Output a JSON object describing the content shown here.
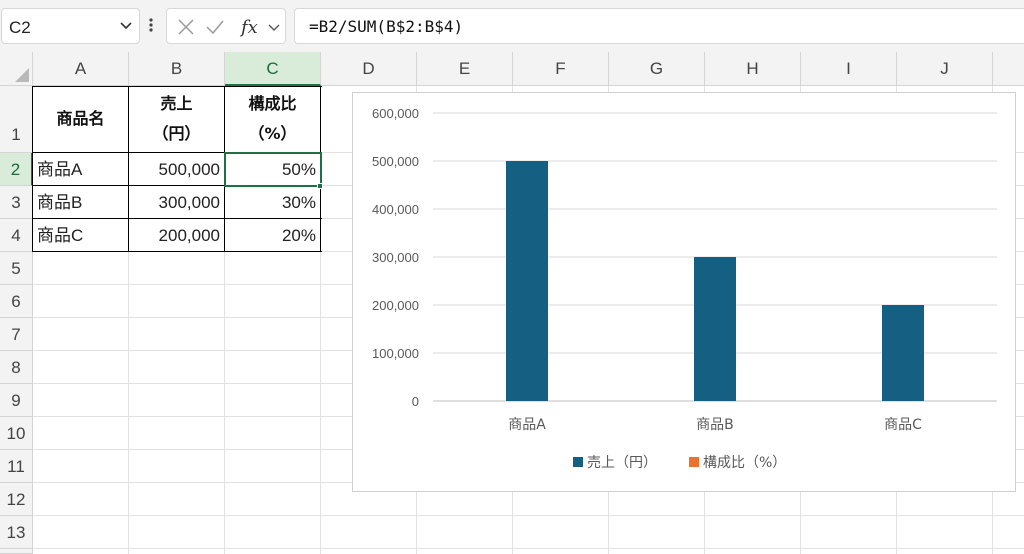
{
  "formula_bar": {
    "name_box": "C2",
    "formula": "=B2/SUM(B$2:B$4)",
    "icons": [
      "chevron-down-icon",
      "more-vert-icon",
      "cancel-x-icon",
      "confirm-check-icon",
      "fx-icon",
      "chevron-down-icon"
    ]
  },
  "columns": [
    "A",
    "B",
    "C",
    "D",
    "E",
    "F",
    "G",
    "H",
    "I",
    "J"
  ],
  "rows": [
    "1",
    "2",
    "3",
    "4",
    "5",
    "6",
    "7",
    "8",
    "9",
    "10",
    "11",
    "12",
    "13"
  ],
  "table": {
    "header": {
      "a": "商品名",
      "b1": "売上",
      "b2": "（円）",
      "c1": "構成比",
      "c2": "（%）"
    },
    "rows": [
      {
        "name": "商品A",
        "sales": "500,000",
        "ratio": "50%"
      },
      {
        "name": "商品B",
        "sales": "300,000",
        "ratio": "30%"
      },
      {
        "name": "商品C",
        "sales": "200,000",
        "ratio": "20%"
      }
    ]
  },
  "colors": {
    "accent": "#1e7145",
    "series1": "#156082",
    "series2": "#e97132"
  },
  "chart_data": {
    "type": "bar",
    "categories": [
      "商品A",
      "商品B",
      "商品C"
    ],
    "series": [
      {
        "name": "売上（円）",
        "values": [
          500000,
          300000,
          200000
        ],
        "color": "#156082"
      },
      {
        "name": "構成比（%）",
        "values": [
          0.5,
          0.3,
          0.2
        ],
        "color": "#e97132"
      }
    ],
    "ylim": [
      0,
      600000
    ],
    "yticks": [
      "600,000",
      "500,000",
      "400,000",
      "300,000",
      "200,000",
      "100,000",
      "0"
    ],
    "grid": true,
    "legend": "bottom"
  }
}
